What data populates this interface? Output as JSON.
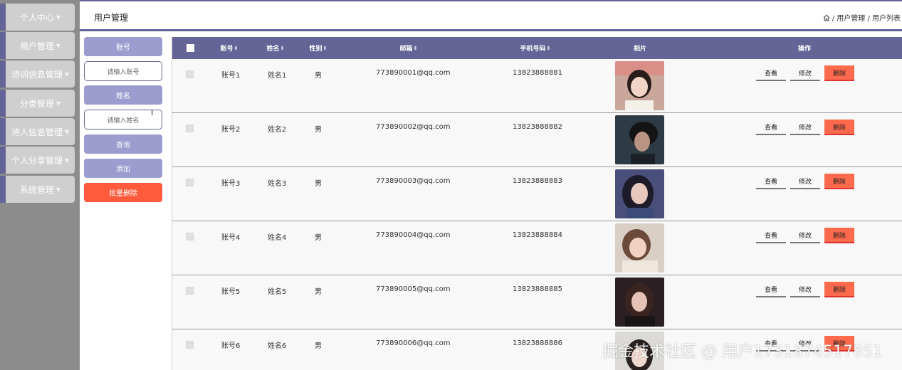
{
  "sidebar": {
    "items": [
      {
        "label": "个人中心"
      },
      {
        "label": "用户管理"
      },
      {
        "label": "诗词信息管理"
      },
      {
        "label": "分类管理"
      },
      {
        "label": "诗人信息管理"
      },
      {
        "label": "个人分享管理"
      },
      {
        "label": "系统管理"
      }
    ]
  },
  "header": {
    "title": "用户管理",
    "breadcrumb": "/ 用户管理 / 用户列表"
  },
  "search": {
    "account_label": "账号",
    "account_placeholder": "请输入账号",
    "name_label": "姓名",
    "name_placeholder": "请输入姓名",
    "query_button": "查询",
    "add_button": "添加",
    "batch_delete_button": "批量删除"
  },
  "table": {
    "columns": {
      "account": "账号",
      "name": "姓名",
      "gender": "性别",
      "email": "邮箱",
      "phone": "手机号码",
      "photo": "相片",
      "actions": "操作"
    },
    "action_labels": {
      "view": "查看",
      "edit": "修改",
      "delete": "删除"
    },
    "rows": [
      {
        "account": "账号1",
        "name": "姓名1",
        "gender": "男",
        "email": "773890001@qq.com",
        "phone": "13823888881"
      },
      {
        "account": "账号2",
        "name": "姓名2",
        "gender": "男",
        "email": "773890002@qq.com",
        "phone": "13823888882"
      },
      {
        "account": "账号3",
        "name": "姓名3",
        "gender": "男",
        "email": "773890003@qq.com",
        "phone": "13823888883"
      },
      {
        "account": "账号4",
        "name": "姓名4",
        "gender": "男",
        "email": "773890004@qq.com",
        "phone": "13823888884"
      },
      {
        "account": "账号5",
        "name": "姓名5",
        "gender": "男",
        "email": "773890005@qq.com",
        "phone": "13823888885"
      },
      {
        "account": "账号6",
        "name": "姓名6",
        "gender": "男",
        "email": "773890006@qq.com",
        "phone": "13823888886"
      }
    ]
  },
  "watermark": "掘金技术社区 @ 用户1731874517851",
  "colors": {
    "primary": "#646496",
    "light_primary": "#9c9cce",
    "danger": "#ff5a3c",
    "sidebar_bg": "#8c8c8c"
  },
  "icons": {
    "home": "home-icon",
    "sort": "sort-icon",
    "caret": "caret-down-icon"
  }
}
